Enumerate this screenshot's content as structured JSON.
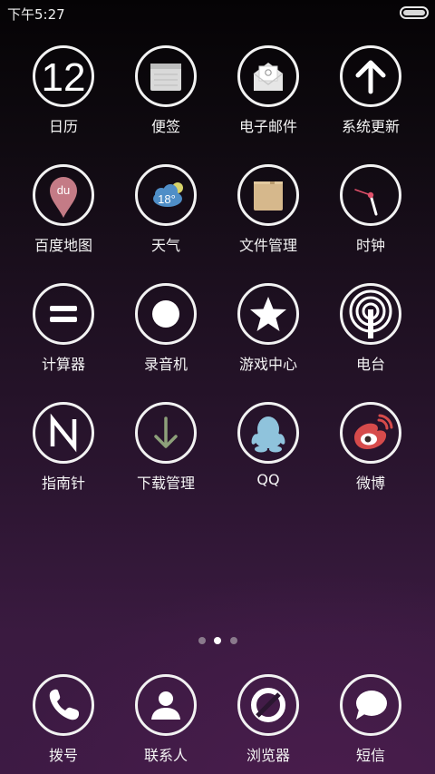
{
  "status_bar": {
    "time": "下午5:27"
  },
  "pager": {
    "page_count": 3,
    "current_page": 2
  },
  "colors": {
    "ring": "#f2f2f2",
    "weibo_red": "#d64b4b",
    "qq_blue": "#8fc3dc",
    "map_pin": "#c47b86",
    "download_arrow": "#8da07a",
    "file_tan": "#d6b88c"
  },
  "apps": [
    {
      "label": "日历",
      "icon": "calendar-icon",
      "value": "12"
    },
    {
      "label": "便签",
      "icon": "notes-icon"
    },
    {
      "label": "电子邮件",
      "icon": "email-icon"
    },
    {
      "label": "系统更新",
      "icon": "arrow-up-icon"
    },
    {
      "label": "百度地图",
      "icon": "map-pin-icon",
      "value": "du"
    },
    {
      "label": "天气",
      "icon": "weather-icon",
      "value": "18°"
    },
    {
      "label": "文件管理",
      "icon": "folder-icon"
    },
    {
      "label": "时钟",
      "icon": "clock-icon"
    },
    {
      "label": "计算器",
      "icon": "equals-icon"
    },
    {
      "label": "录音机",
      "icon": "record-icon"
    },
    {
      "label": "游戏中心",
      "icon": "star-icon"
    },
    {
      "label": "电台",
      "icon": "radio-icon"
    },
    {
      "label": "指南针",
      "icon": "compass-n-icon"
    },
    {
      "label": "下载管理",
      "icon": "download-icon"
    },
    {
      "label": "QQ",
      "icon": "qq-penguin-icon"
    },
    {
      "label": "微博",
      "icon": "weibo-icon"
    }
  ],
  "dock": [
    {
      "label": "拨号",
      "icon": "phone-icon"
    },
    {
      "label": "联系人",
      "icon": "contact-icon"
    },
    {
      "label": "浏览器",
      "icon": "browser-icon"
    },
    {
      "label": "短信",
      "icon": "message-icon"
    }
  ]
}
